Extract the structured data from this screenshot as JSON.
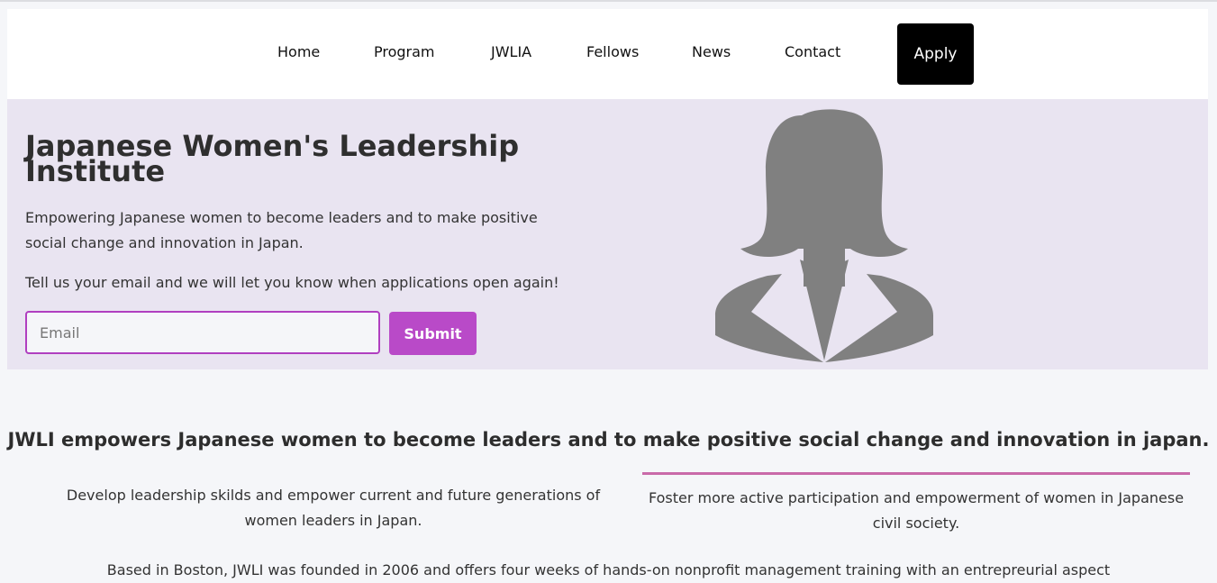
{
  "nav": {
    "items": [
      "Home",
      "Program",
      "JWLIA",
      "Fellows",
      "News",
      "Contact"
    ],
    "apply_label": "Apply"
  },
  "hero": {
    "title": "Japanese Women's Leadership Institute",
    "description": "Empowering Japanese women to become leaders and to make positive social change and innovation in Japan.",
    "prompt": "Tell us your email and we will let you know when applications open again!",
    "email_placeholder": "Email",
    "submit_label": "Submit"
  },
  "mission": {
    "headline": "JWLI empowers Japanese women to become leaders and to make positive social change and innovation in japan.",
    "goals": [
      "Develop leadership skilds and empower current and future generations of women leaders in Japan.",
      "Foster more active participation and empowerment of women in Japanese civil society."
    ],
    "about": "Based in Boston, JWLI was founded in 2006 and offers four weeks of hands-on nonprofit management training with an entrepreurial aspect"
  },
  "colors": {
    "hero_bg": "#e9e4f1",
    "accent": "#b94ac8",
    "divider": "#c96aa9",
    "apply_bg": "#000000"
  },
  "icons": {
    "hero_image": "woman-silhouette-icon"
  }
}
